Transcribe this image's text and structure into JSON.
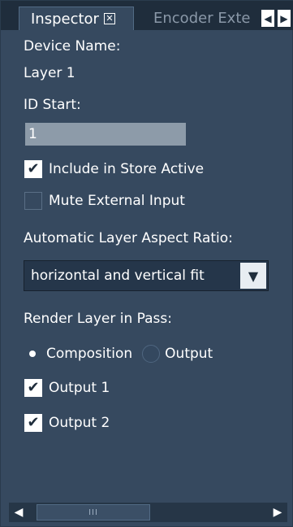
{
  "tabs": {
    "active": "Inspector",
    "inactive": "Encoder Exte",
    "prev_icon": "triangle-left-icon",
    "next_icon": "triangle-right-icon"
  },
  "device_name": {
    "label": "Device Name:",
    "value": "Layer 1"
  },
  "id_start": {
    "label": "ID Start:",
    "value": "1"
  },
  "checkboxes": {
    "include_store_active": {
      "label": "Include in Store Active",
      "checked": true
    },
    "mute_external_input": {
      "label": "Mute External Input",
      "checked": false
    }
  },
  "aspect_ratio": {
    "label": "Automatic Layer Aspect Ratio:",
    "selected": "horizontal and vertical fit"
  },
  "render_pass": {
    "label": "Render Layer in Pass:",
    "options": [
      {
        "label": "Composition",
        "selected": true
      },
      {
        "label": "Output",
        "selected": false
      }
    ],
    "outputs": [
      {
        "label": "Output 1",
        "checked": true
      },
      {
        "label": "Output 2",
        "checked": true
      }
    ]
  },
  "scrollbar": {
    "thumb_grip": "III"
  },
  "colors": {
    "panel_bg": "#36495f",
    "tabbar_bg": "#1f2d3c",
    "input_bg": "#8d9ba9"
  }
}
